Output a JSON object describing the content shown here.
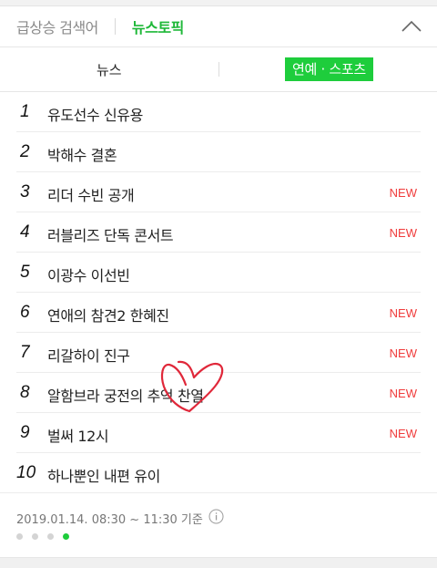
{
  "header": {
    "tab_rising": "급상승 검색어",
    "tab_news_topic": "뉴스토픽",
    "collapse_icon": "chevron-up-icon"
  },
  "subtabs": {
    "news": "뉴스",
    "entertainment_sports": "연예 · 스포츠"
  },
  "list": [
    {
      "rank": "1",
      "keyword": "유도선수 신유용",
      "badge": ""
    },
    {
      "rank": "2",
      "keyword": "박해수 결혼",
      "badge": ""
    },
    {
      "rank": "3",
      "keyword": "리더 수빈 공개",
      "badge": "NEW"
    },
    {
      "rank": "4",
      "keyword": "러블리즈 단독 콘서트",
      "badge": "NEW"
    },
    {
      "rank": "5",
      "keyword": "이광수 이선빈",
      "badge": ""
    },
    {
      "rank": "6",
      "keyword": "연애의 참견2 한혜진",
      "badge": "NEW"
    },
    {
      "rank": "7",
      "keyword": "리갈하이 진구",
      "badge": "NEW"
    },
    {
      "rank": "8",
      "keyword": "알함브라 궁전의 추억 찬열",
      "badge": "NEW"
    },
    {
      "rank": "9",
      "keyword": "벌써 12시",
      "badge": "NEW"
    },
    {
      "rank": "10",
      "keyword": "하나뿐인 내편 유이",
      "badge": ""
    }
  ],
  "footer": {
    "timestamp": "2019.01.14. 08:30 ~ 11:30 기준",
    "info_icon": "info-icon",
    "page_indicator": {
      "total": 4,
      "active": 4
    }
  },
  "colors": {
    "accent_green": "#1ecd3c",
    "new_red": "#f03c3c",
    "scribble_red": "#e0283a"
  }
}
